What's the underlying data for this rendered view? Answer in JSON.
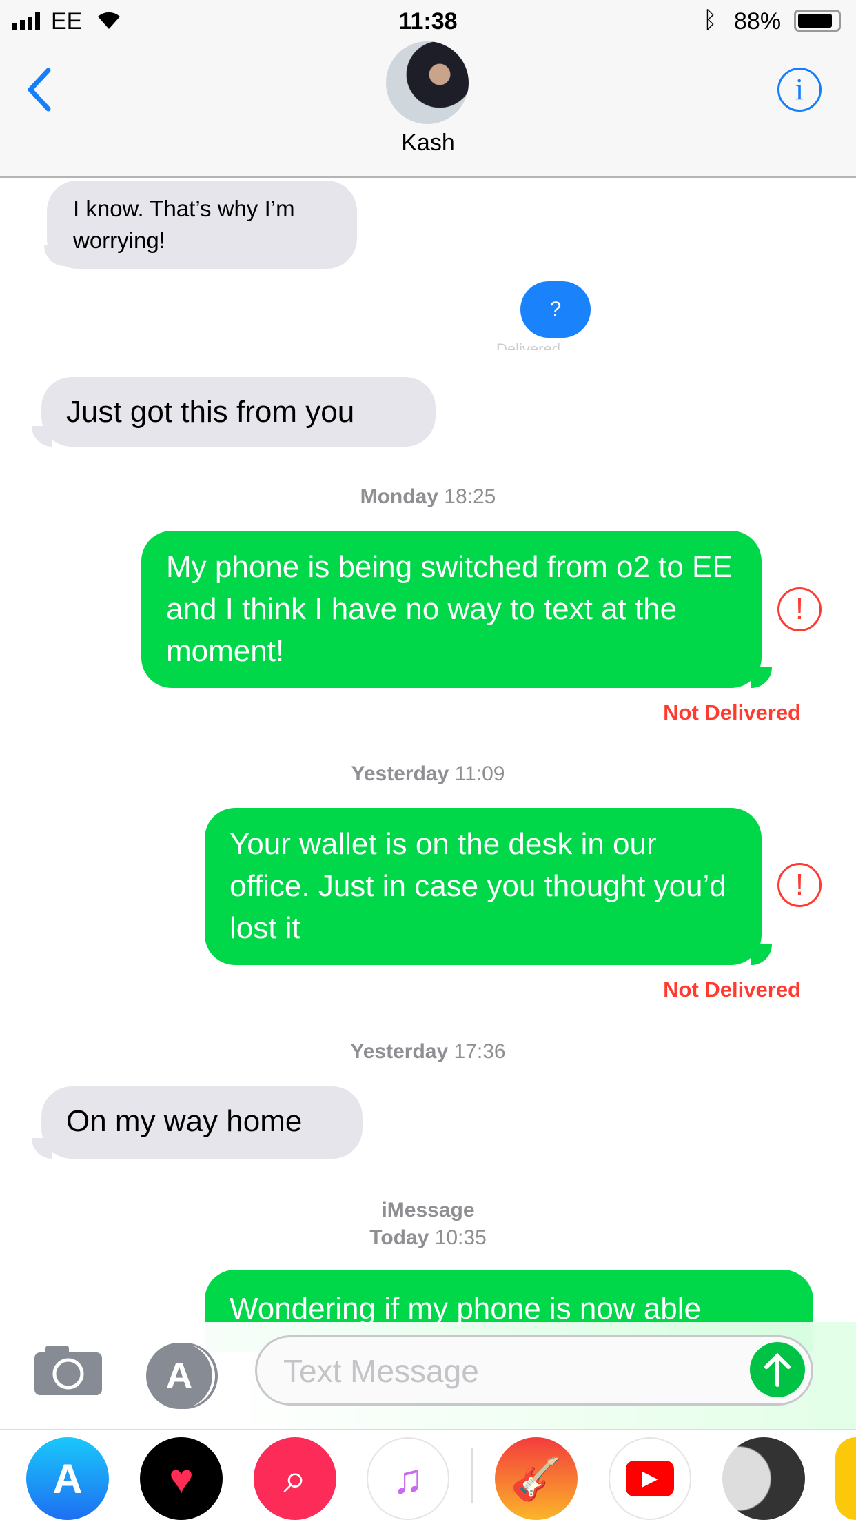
{
  "status_bar": {
    "carrier": "EE",
    "time": "11:38",
    "battery": "88%"
  },
  "header": {
    "contact_name": "Kash",
    "back_icon": "chevron-left-icon",
    "info_icon": "info-icon"
  },
  "messages": [
    {
      "side": "incoming",
      "text": "I know. That’s why I’m worrying!"
    },
    {
      "side": "outgoing",
      "text": "?",
      "status": "Delivered",
      "color": "#1a82fb"
    },
    {
      "side": "incoming",
      "text": "Just got this from you"
    },
    {
      "timestamp_day": "Monday",
      "timestamp_time": "18:25"
    },
    {
      "side": "outgoing",
      "text": "My phone is being switched from o2 to EE and I think I have no way to text at the moment!",
      "status": "Not Delivered"
    },
    {
      "timestamp_day": "Yesterday",
      "timestamp_time": "11:09"
    },
    {
      "side": "outgoing",
      "text": "Your wallet is on the desk in our office. Just in case you thought you’d lost it",
      "status": "Not Delivered"
    },
    {
      "timestamp_day": "Yesterday",
      "timestamp_time": "17:36"
    },
    {
      "side": "incoming",
      "text": "On my way home"
    },
    {
      "service": "iMessage",
      "timestamp_day": "Today",
      "timestamp_time": "10:35"
    },
    {
      "side": "outgoing",
      "text": "Wondering if my phone is now able"
    }
  ],
  "input": {
    "placeholder": "Text Message"
  },
  "dock": [
    "app-store",
    "digital-touch",
    "image-search",
    "music",
    "garageband",
    "youtube",
    "moon",
    "emoji"
  ],
  "colors": {
    "sms_green": "#00d84a",
    "imessage_blue": "#1a82fb",
    "error_red": "#ff3b30",
    "accent": "#147efb"
  }
}
